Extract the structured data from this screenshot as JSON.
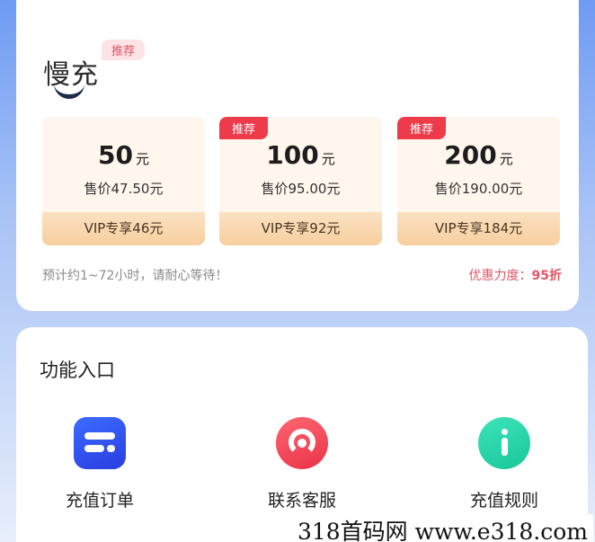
{
  "slow_charge": {
    "title": "慢充",
    "tag": "推荐",
    "options": [
      {
        "amount": "50",
        "unit": "元",
        "price": "售价47.50元",
        "vip": "VIP专享46元",
        "tag": ""
      },
      {
        "amount": "100",
        "unit": "元",
        "price": "售价95.00元",
        "vip": "VIP专享92元",
        "tag": "推荐"
      },
      {
        "amount": "200",
        "unit": "元",
        "price": "售价190.00元",
        "vip": "VIP专享184元",
        "tag": "推荐"
      }
    ],
    "wait_note": "预计约1~72小时，请耐心等待！",
    "discount_label": "优惠力度：",
    "discount_value": "95折"
  },
  "functions": {
    "title": "功能入口",
    "items": [
      {
        "label": "充值订单",
        "icon": "order-icon"
      },
      {
        "label": "联系客服",
        "icon": "headset-icon"
      },
      {
        "label": "充值规则",
        "icon": "info-icon"
      }
    ]
  },
  "watermark": "318首码网  www.e318.com",
  "colors": {
    "accent_red": "#e25567",
    "tag_red": "#ee3b4b",
    "vip_gold": "#f7cf9f"
  }
}
